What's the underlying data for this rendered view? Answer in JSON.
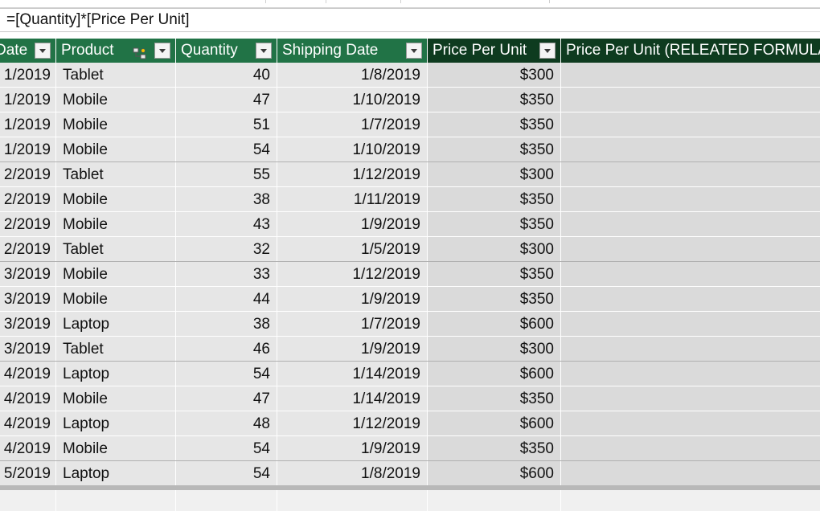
{
  "formula_bar": {
    "text": "=[Quantity]*[Price Per Unit]"
  },
  "columns": [
    {
      "key": "date",
      "label": "Date",
      "has_filter": true
    },
    {
      "key": "product",
      "label": "Product",
      "has_filter": true,
      "relationship_icon": "table-relationship-icon"
    },
    {
      "key": "quantity",
      "label": "Quantity",
      "has_filter": true
    },
    {
      "key": "shipping",
      "label": "Shipping Date",
      "has_filter": true
    },
    {
      "key": "price",
      "label": "Price Per Unit",
      "has_filter": true,
      "selected": true
    },
    {
      "key": "related",
      "label": "Price Per Unit (RELEATED FORMULA",
      "has_filter": false,
      "selected": true
    }
  ],
  "rows": [
    {
      "date": "1/2019",
      "product": "Tablet",
      "quantity": "40",
      "shipping": "1/8/2019",
      "price": "$300",
      "related": ""
    },
    {
      "date": "1/2019",
      "product": "Mobile",
      "quantity": "47",
      "shipping": "1/10/2019",
      "price": "$350",
      "related": ""
    },
    {
      "date": "1/2019",
      "product": "Mobile",
      "quantity": "51",
      "shipping": "1/7/2019",
      "price": "$350",
      "related": ""
    },
    {
      "date": "1/2019",
      "product": "Mobile",
      "quantity": "54",
      "shipping": "1/10/2019",
      "price": "$350",
      "related": ""
    },
    {
      "date": "2/2019",
      "product": "Tablet",
      "quantity": "55",
      "shipping": "1/12/2019",
      "price": "$300",
      "related": ""
    },
    {
      "date": "2/2019",
      "product": "Mobile",
      "quantity": "38",
      "shipping": "1/11/2019",
      "price": "$350",
      "related": ""
    },
    {
      "date": "2/2019",
      "product": "Mobile",
      "quantity": "43",
      "shipping": "1/9/2019",
      "price": "$350",
      "related": ""
    },
    {
      "date": "2/2019",
      "product": "Tablet",
      "quantity": "32",
      "shipping": "1/5/2019",
      "price": "$300",
      "related": ""
    },
    {
      "date": "3/2019",
      "product": "Mobile",
      "quantity": "33",
      "shipping": "1/12/2019",
      "price": "$350",
      "related": ""
    },
    {
      "date": "3/2019",
      "product": "Mobile",
      "quantity": "44",
      "shipping": "1/9/2019",
      "price": "$350",
      "related": ""
    },
    {
      "date": "3/2019",
      "product": "Laptop",
      "quantity": "38",
      "shipping": "1/7/2019",
      "price": "$600",
      "related": ""
    },
    {
      "date": "3/2019",
      "product": "Tablet",
      "quantity": "46",
      "shipping": "1/9/2019",
      "price": "$300",
      "related": ""
    },
    {
      "date": "4/2019",
      "product": "Laptop",
      "quantity": "54",
      "shipping": "1/14/2019",
      "price": "$600",
      "related": ""
    },
    {
      "date": "4/2019",
      "product": "Mobile",
      "quantity": "47",
      "shipping": "1/14/2019",
      "price": "$350",
      "related": ""
    },
    {
      "date": "4/2019",
      "product": "Laptop",
      "quantity": "48",
      "shipping": "1/12/2019",
      "price": "$600",
      "related": ""
    },
    {
      "date": "4/2019",
      "product": "Mobile",
      "quantity": "54",
      "shipping": "1/9/2019",
      "price": "$350",
      "related": ""
    },
    {
      "date": "5/2019",
      "product": "Laptop",
      "quantity": "54",
      "shipping": "1/8/2019",
      "price": "$600",
      "related": ""
    }
  ],
  "colors": {
    "header_green": "#217346",
    "header_selected": "#0e3b1f",
    "cell_bg": "#e6e6e6",
    "cell_selected_bg": "#dadada"
  }
}
